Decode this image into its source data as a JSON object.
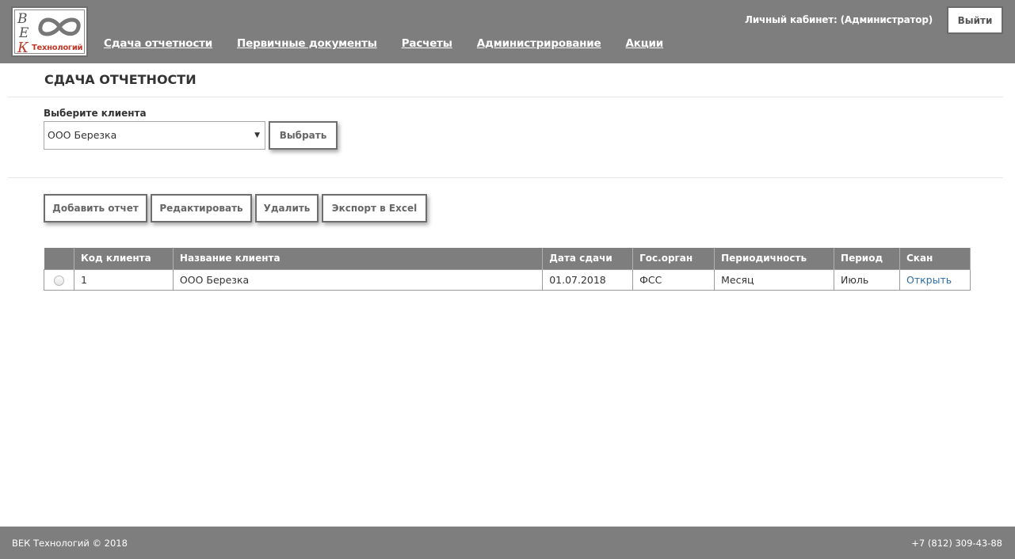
{
  "header": {
    "logo": {
      "letters": [
        "В",
        "Е",
        "К"
      ],
      "text": "Технологий"
    },
    "nav": [
      "Сдача отчетности",
      "Первичные документы",
      "Расчеты",
      "Администрирование",
      "Акции"
    ],
    "user_label": "Личный кабинет: (Администратор)",
    "logout_label": "Выйти"
  },
  "page": {
    "title": "СДАЧА ОТЧЕТНОСТИ"
  },
  "client_filter": {
    "label": "Выберите клиента",
    "selected": "ООО Березка",
    "select_button": "Выбрать"
  },
  "toolbar": {
    "add": "Добавить отчет",
    "edit": "Редактировать",
    "delete": "Удалить",
    "export": "Экспорт в Excel"
  },
  "table": {
    "columns": [
      "Код клиента",
      "Название клиента",
      "Дата сдачи",
      "Гос.орган",
      "Периодичность",
      "Период",
      "Скан"
    ],
    "rows": [
      {
        "code": "1",
        "name": "ООО Березка",
        "date": "01.07.2018",
        "agency": "ФСС",
        "frequency": "Месяц",
        "period": "Июль",
        "scan": "Открыть"
      }
    ]
  },
  "footer": {
    "copyright": "ВЕК Технологий © 2018",
    "phone": "+7 (812) 309-43-88"
  },
  "colors": {
    "header_bg": "#7e7e7e",
    "logo_accent": "#c0392b",
    "link": "#2e6da4"
  }
}
